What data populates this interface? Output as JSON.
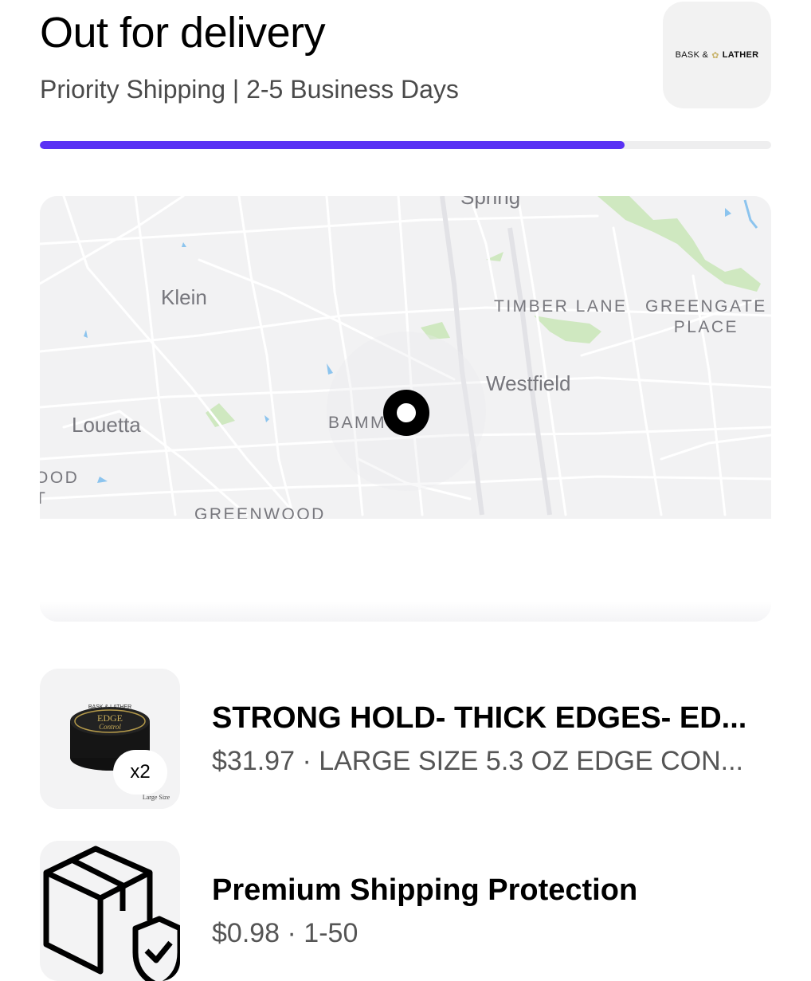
{
  "header": {
    "status_title": "Out for delivery",
    "shipping_method": "Priority Shipping | 2-5 Business Days",
    "store_logo": {
      "part1": "BASK &",
      "part2": "LATHER",
      "accent_color": "#c8b36a"
    }
  },
  "progress": {
    "fraction": 0.8,
    "fill_color": "#5a31f4",
    "track_color": "#eeeeef"
  },
  "map": {
    "labels": {
      "spring": "Spring",
      "klein": "Klein",
      "timber_lane": "TIMBER LANE",
      "greengate": [
        "GREENGATE",
        "PLACE"
      ],
      "westfield": "Westfield",
      "louetta": "Louetta",
      "bamm": "BAMM",
      "ood": [
        "OOD",
        "T"
      ],
      "greenwood": "GREENWOOD"
    },
    "marker_icon": "location-pin-icon"
  },
  "items": [
    {
      "title": "STRONG HOLD- THICK EDGES- ED...",
      "subtitle": "$31.97 · LARGE SIZE 5.3 OZ EDGE CON...",
      "quantity": "x2",
      "thumb_icon": "edge-control-jar-icon",
      "thumb_text": {
        "brand": "BASK & LATHER",
        "product_line1": "EDGE",
        "product_line2": "Control",
        "size": "Large Size"
      }
    },
    {
      "title": "Premium Shipping Protection",
      "subtitle": "$0.98 · 1-50",
      "thumb_icon": "package-shield-icon"
    }
  ]
}
